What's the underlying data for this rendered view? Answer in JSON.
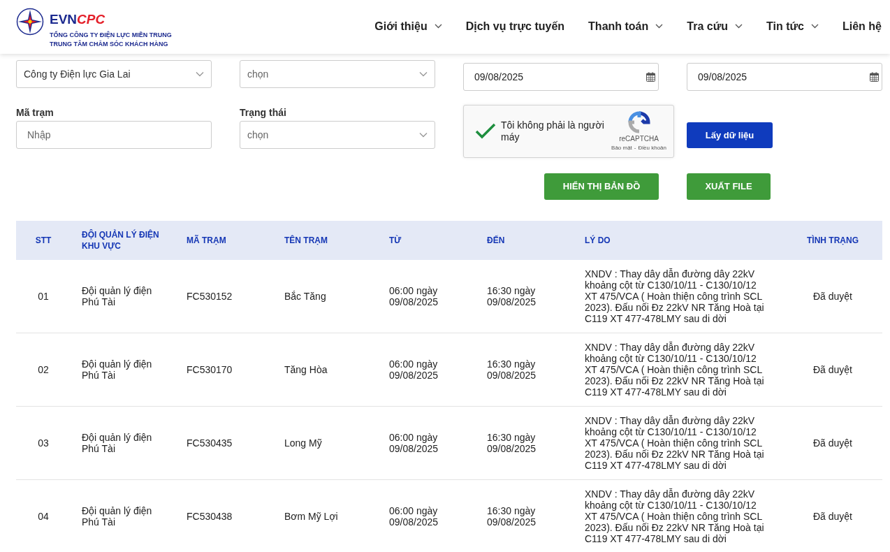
{
  "header": {
    "logo": {
      "brand_left": "EVN",
      "brand_right": "CPC",
      "line_1": "TỔNG CÔNG TY ĐIỆN LỰC MIỀN TRUNG",
      "line_2": "TRUNG TÂM CHĂM SÓC KHÁCH HÀNG"
    },
    "nav": [
      {
        "label": "Giới thiệu",
        "has_dropdown": true
      },
      {
        "label": "Dịch vụ trực tuyến",
        "has_dropdown": false
      },
      {
        "label": "Thanh toán",
        "has_dropdown": true
      },
      {
        "label": "Tra cứu",
        "has_dropdown": true
      },
      {
        "label": "Tin tức",
        "has_dropdown": true
      },
      {
        "label": "Liên hệ",
        "has_dropdown": false
      }
    ]
  },
  "filters": {
    "company": {
      "value": "Công ty Điện lực Gia Lai"
    },
    "unit": {
      "placeholder": "chọn"
    },
    "from_date": {
      "value": "09/08/2025"
    },
    "to_date": {
      "value": "09/08/2025"
    },
    "station_code": {
      "label": "Mã trạm",
      "placeholder": "Nhập"
    },
    "status": {
      "label": "Trạng thái",
      "placeholder": "chọn"
    },
    "captcha": {
      "label": "Tôi không phải là người máy",
      "checked": true,
      "brand": "reCAPTCHA",
      "privacy": "Bảo mật",
      "separator": "-",
      "terms": "Điều khoản"
    },
    "buttons": [
      {
        "label": "Lấy dữ liệu",
        "kind": "primary"
      },
      {
        "label": "HIỂN THỊ BẢN ĐỒ",
        "kind": "success"
      },
      {
        "label": "XUẤT FILE",
        "kind": "success"
      }
    ]
  },
  "table": {
    "columns": [
      "STT",
      "ĐỘI QUẢN LÝ ĐIỆN KHU VỰC",
      "MÃ TRẠM",
      "TÊN TRẠM",
      "TỪ",
      "ĐẾN",
      "LÝ DO",
      "TÌNH TRẠNG"
    ],
    "rows": [
      [
        "01",
        "Đội quản lý điện Phú Tài",
        "FC530152",
        "Bắc Tăng",
        "06:00 ngày 09/08/2025",
        "16:30 ngày 09/08/2025",
        "XNDV : Thay dây dẫn đường dây 22kV khoảng cột từ C130/10/11 - C130/10/12 XT 475/VCA ( Hoàn thiện công trình SCL 2023). Đấu nối Đz 22kV NR Tăng Hoà tại C119 XT 477-478LMY sau di dời",
        "Đã duyệt"
      ],
      [
        "02",
        "Đội quản lý điện Phú Tài",
        "FC530170",
        "Tăng Hòa",
        "06:00 ngày 09/08/2025",
        "16:30 ngày 09/08/2025",
        "XNDV : Thay dây dẫn đường dây 22kV khoảng cột từ C130/10/11 - C130/10/12 XT 475/VCA ( Hoàn thiện công trình SCL 2023). Đấu nối Đz 22kV NR Tăng Hoà tại C119 XT 477-478LMY sau di dời",
        "Đã duyệt"
      ],
      [
        "03",
        "Đội quản lý điện Phú Tài",
        "FC530435",
        "Long Mỹ",
        "06:00 ngày 09/08/2025",
        "16:30 ngày 09/08/2025",
        "XNDV : Thay dây dẫn đường dây 22kV khoảng cột từ C130/10/11 - C130/10/12 XT 475/VCA ( Hoàn thiện công trình SCL 2023). Đấu nối Đz 22kV NR Tăng Hoà tại C119 XT 477-478LMY sau di dời",
        "Đã duyệt"
      ],
      [
        "04",
        "Đội quản lý điện Phú Tài",
        "FC530438",
        "Bơm Mỹ Lợi",
        "06:00 ngày 09/08/2025",
        "16:30 ngày 09/08/2025",
        "XNDV : Thay dây dẫn đường dây 22kV khoảng cột từ C130/10/11 - C130/10/12 XT 475/VCA ( Hoàn thiện công trình SCL 2023). Đấu nối Đz 22kV NR Tăng Hoà tại C119 XT 477-478LMY sau di dời",
        "Đã duyệt"
      ]
    ]
  }
}
